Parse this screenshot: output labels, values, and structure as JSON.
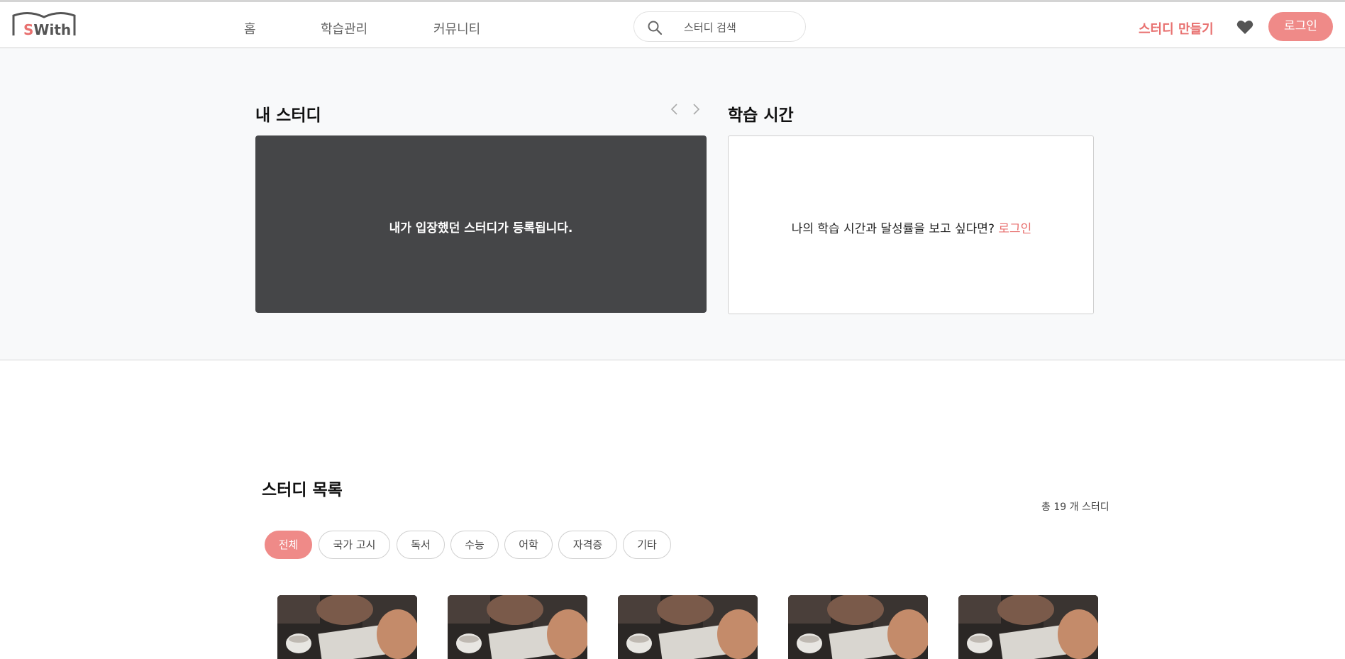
{
  "header": {
    "logo_text_s": "S",
    "logo_text_rest": "With",
    "nav": [
      "홈",
      "학습관리",
      "커뮤니티"
    ],
    "search_placeholder": "스터디 검색",
    "make_study": "스터디 만들기",
    "login": "로그인"
  },
  "my_study": {
    "title": "내 스터디",
    "empty_message": "내가 입장했던 스터디가 등록됩니다."
  },
  "study_time": {
    "title": "학습 시간",
    "prompt": "나의 학습 시간과 달성률을 보고 싶다면?",
    "login_link": "로그인"
  },
  "study_list": {
    "title": "스터디 목록",
    "total_prefix": "총",
    "total_count": "19",
    "total_suffix": "개 스터디",
    "categories": [
      "전체",
      "국가 고시",
      "독서",
      "수능",
      "어학",
      "자격증",
      "기타"
    ],
    "active_category": "전체"
  },
  "colors": {
    "accent": "#ef8a88",
    "accent_text": "#e8706f",
    "dark_card": "#454648"
  },
  "icons": {
    "search": "search-icon",
    "heart": "heart-icon",
    "prev": "chevron-left-icon",
    "next": "chevron-right-icon"
  }
}
